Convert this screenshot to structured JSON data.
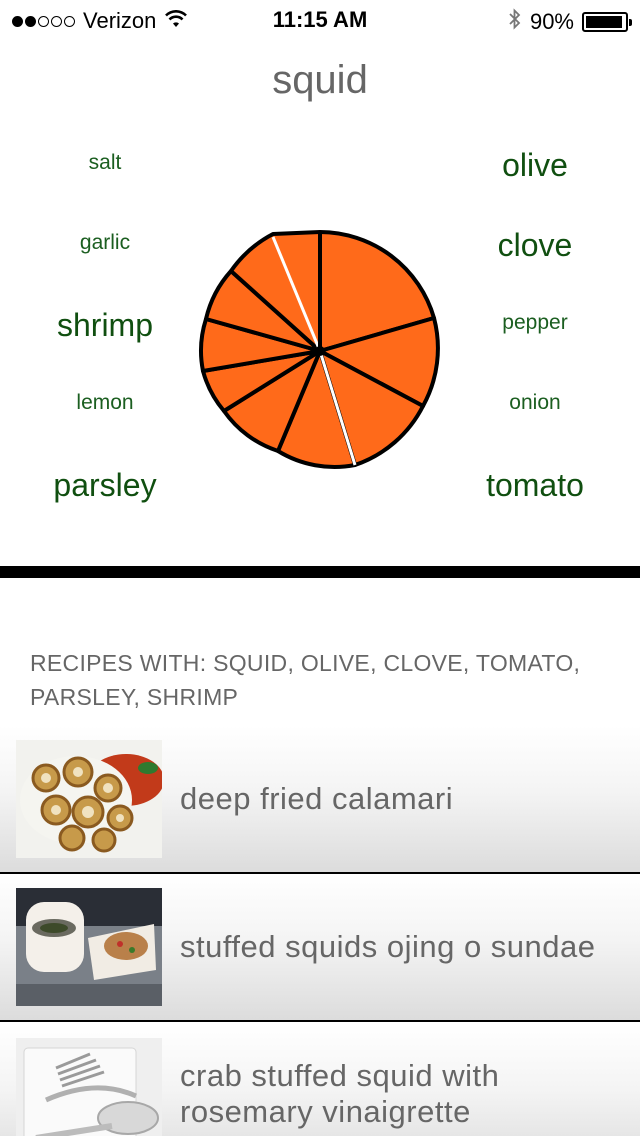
{
  "status_bar": {
    "carrier": "Verizon",
    "time": "11:15 AM",
    "battery": "90%",
    "signal_bars_filled": 2,
    "signal_bars_total": 5
  },
  "title": "squid",
  "ingredients_left": [
    {
      "name": "salt",
      "size": "small"
    },
    {
      "name": "garlic",
      "size": "small"
    },
    {
      "name": "shrimp",
      "size": "big"
    },
    {
      "name": "lemon",
      "size": "small"
    },
    {
      "name": "parsley",
      "size": "big"
    }
  ],
  "ingredients_right": [
    {
      "name": "olive",
      "size": "big"
    },
    {
      "name": "clove",
      "size": "big"
    },
    {
      "name": "pepper",
      "size": "small"
    },
    {
      "name": "onion",
      "size": "small"
    },
    {
      "name": "tomato",
      "size": "big"
    }
  ],
  "colors": {
    "pie_fill": "#ff6a1a",
    "ingredient_text": "#1b5e20",
    "divider": "#000000"
  },
  "recipes_header": "RECIPES WITH: SQUID, OLIVE, CLOVE, TOMATO, PARSLEY, SHRIMP",
  "recipes": [
    {
      "title": "deep fried calamari",
      "thumb_icon": "fried-calamari-photo"
    },
    {
      "title": "stuffed squids ojing o sundae",
      "thumb_icon": "stuffed-squid-photo"
    },
    {
      "title": "crab stuffed squid with rosemary vinaigrette",
      "thumb_icon": "fork-spoon-placeholder"
    }
  ]
}
